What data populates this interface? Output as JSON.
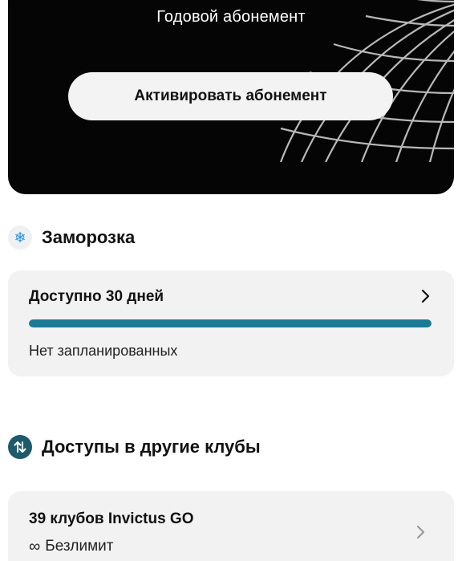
{
  "membership_card": {
    "title": "Годовой абонемент",
    "activate_label": "Активировать абонемент",
    "background_color": "#050505"
  },
  "freeze": {
    "section_title": "Заморозка",
    "icon": "snowflake-icon",
    "available_text": "Доступно 30 дней",
    "progress_percent": 100,
    "progress_color": "#1d7a96",
    "status_text": "Нет запланированных"
  },
  "club_access": {
    "section_title": "Доступы в другие клубы",
    "icon": "swap-arrows-icon",
    "clubs_title": "39 клубов Invictus GO",
    "infinity_symbol": "∞",
    "limit_text": "Безлимит"
  }
}
